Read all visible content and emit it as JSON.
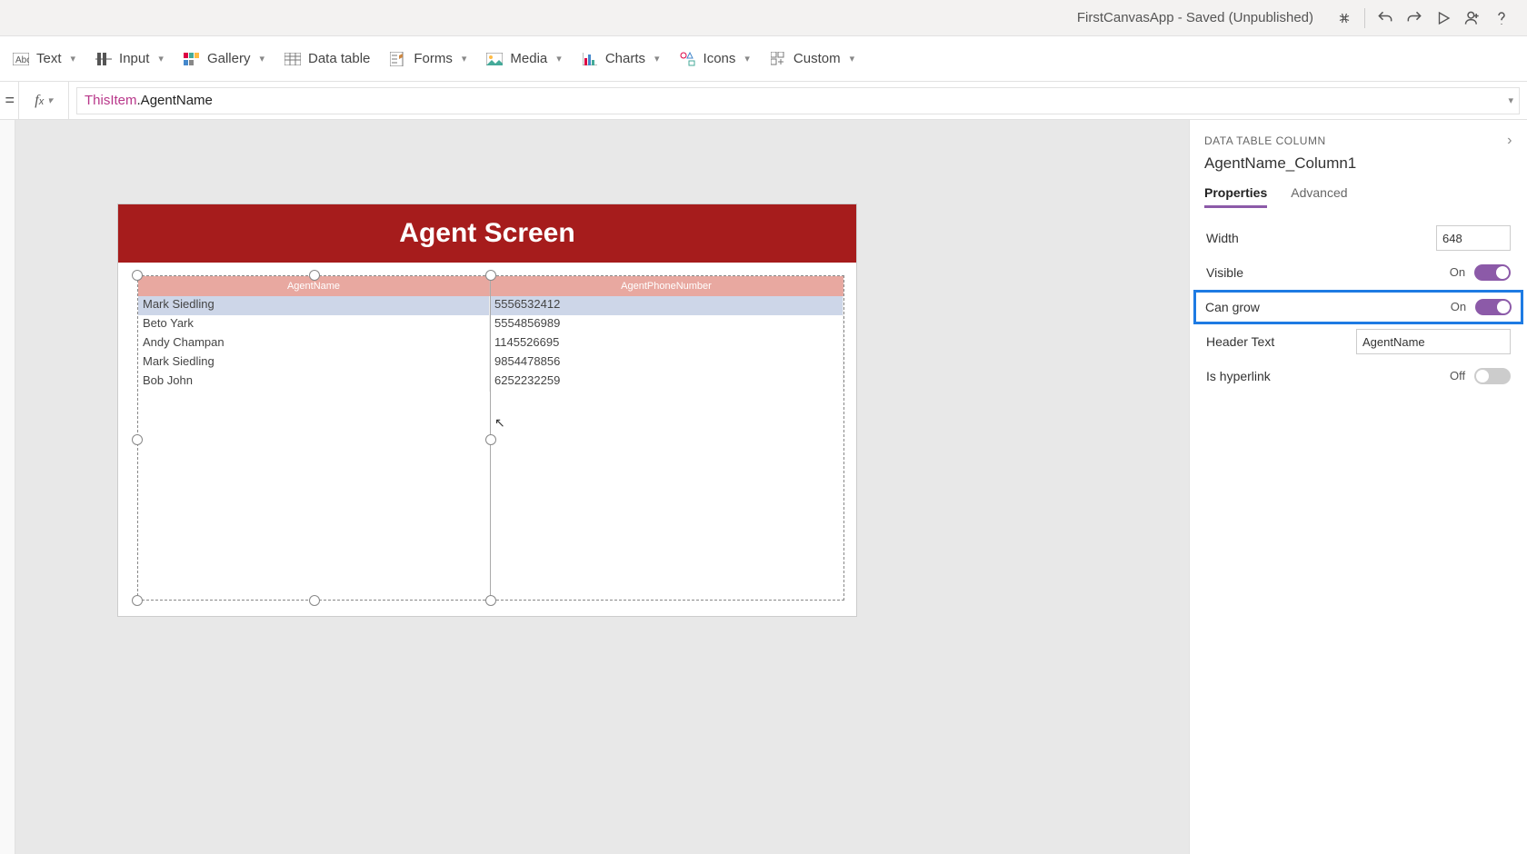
{
  "titlebar": {
    "app_title": "FirstCanvasApp - Saved (Unpublished)"
  },
  "toolbar": {
    "text": "Text",
    "input": "Input",
    "gallery": "Gallery",
    "datatable": "Data table",
    "forms": "Forms",
    "media": "Media",
    "charts": "Charts",
    "icons": "Icons",
    "custom": "Custom"
  },
  "formula_bar": {
    "this_item": "ThisItem",
    "prop": ".AgentName"
  },
  "screen": {
    "title": "Agent Screen",
    "columns": [
      "AgentName",
      "AgentPhoneNumber"
    ],
    "rows": [
      {
        "name": "Mark Siedling",
        "phone": "5556532412"
      },
      {
        "name": "Beto Yark",
        "phone": "5554856989"
      },
      {
        "name": "Andy Champan",
        "phone": "1145526695"
      },
      {
        "name": "Mark Siedling",
        "phone": "9854478856"
      },
      {
        "name": "Bob John",
        "phone": "6252232259"
      }
    ]
  },
  "properties": {
    "panel_title": "DATA TABLE COLUMN",
    "control_name": "AgentName_Column1",
    "tab_properties": "Properties",
    "tab_advanced": "Advanced",
    "width_label": "Width",
    "width_value": "648",
    "visible_label": "Visible",
    "visible_state": "On",
    "cangrow_label": "Can grow",
    "cangrow_state": "On",
    "headertext_label": "Header Text",
    "headertext_value": "AgentName",
    "hyperlink_label": "Is hyperlink",
    "hyperlink_state": "Off"
  }
}
